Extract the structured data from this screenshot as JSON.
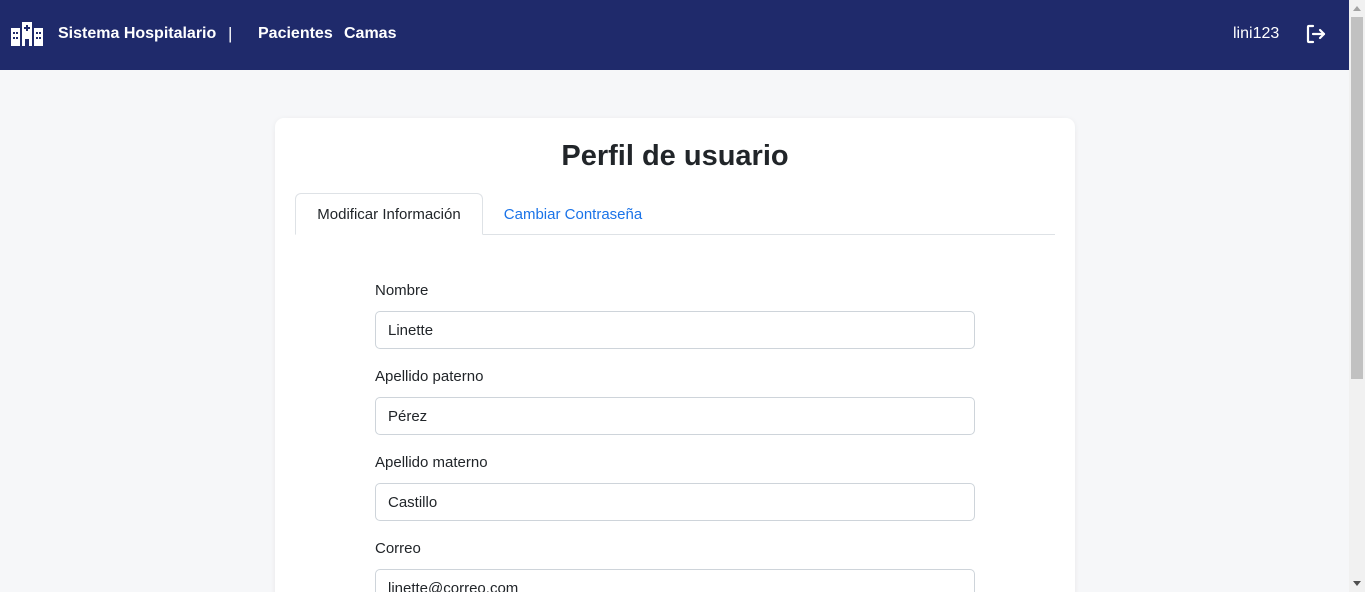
{
  "navbar": {
    "brand_icon": "hospital-icon",
    "brand_name": "Sistema Hospitalario",
    "separator": "|",
    "links": [
      "Pacientes",
      "Camas"
    ],
    "username": "lini123",
    "logout_icon": "logout-icon",
    "bg_color": "#1f2a6b"
  },
  "profile": {
    "title": "Perfil de usuario",
    "tabs": [
      {
        "label": "Modificar Información",
        "active": true
      },
      {
        "label": "Cambiar Contraseña",
        "active": false
      }
    ],
    "fields": [
      {
        "label": "Nombre",
        "value": "Linette"
      },
      {
        "label": "Apellido paterno",
        "value": "Pérez"
      },
      {
        "label": "Apellido materno",
        "value": "Castillo"
      },
      {
        "label": "Correo",
        "value": "linette@correo.com"
      }
    ]
  },
  "colors": {
    "accent_link": "#1a73e8",
    "page_bg": "#f6f7f9"
  }
}
